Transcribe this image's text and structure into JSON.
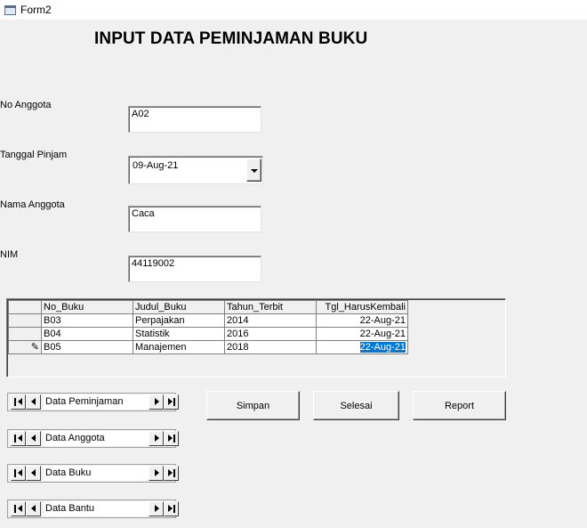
{
  "window": {
    "title": "Form2"
  },
  "heading": "INPUT DATA PEMINJAMAN BUKU",
  "fields": {
    "no_anggota": {
      "label": "No Anggota",
      "value": "A02"
    },
    "tanggal_pinjam": {
      "label": "Tanggal Pinjam",
      "value": "09-Aug-21"
    },
    "nama_anggota": {
      "label": "Nama Anggota",
      "value": "Caca"
    },
    "nim": {
      "label": "NIM",
      "value": "44119002"
    }
  },
  "grid": {
    "columns": [
      "No_Buku",
      "Judul_Buku",
      "Tahun_Terbit",
      "Tgl_HarusKembali"
    ],
    "rows": [
      [
        "B03",
        "Perpajakan",
        "2014",
        "22-Aug-21"
      ],
      [
        "B04",
        "Statistik",
        "2016",
        "22-Aug-21"
      ],
      [
        "B05",
        "Manajemen",
        "2018",
        "22-Aug-21"
      ]
    ],
    "edit_row_indicator": "✎"
  },
  "buttons": {
    "simpan": "Simpan",
    "selesai": "Selesai",
    "report": "Report"
  },
  "data_controls": [
    {
      "caption": "Data Peminjaman"
    },
    {
      "caption": "Data Anggota"
    },
    {
      "caption": "Data Buku"
    },
    {
      "caption": "Data Bantu"
    }
  ],
  "icons": {
    "app": "form-window-icon",
    "combo": "dropdown-arrow-icon",
    "nav": [
      "move-first-icon",
      "move-previous-icon",
      "move-next-icon",
      "move-last-icon"
    ]
  },
  "colors": {
    "selection": "#0078d7",
    "form_background": "#f0f0f0"
  }
}
